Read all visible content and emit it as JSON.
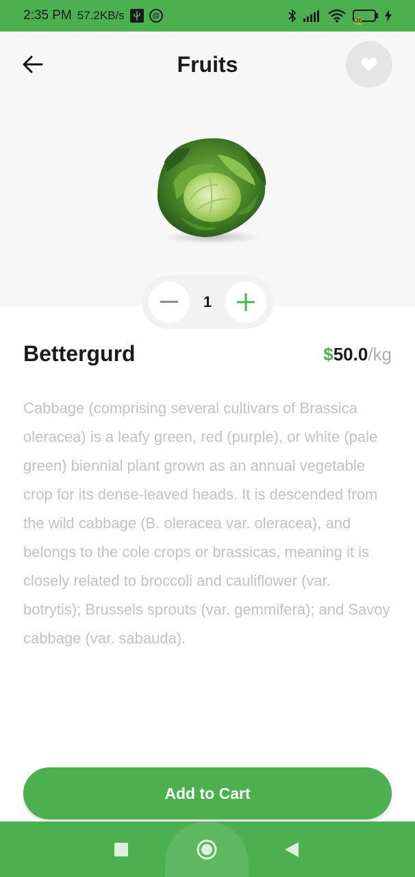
{
  "status_bar": {
    "time": "2:35 PM",
    "speed": "57.2KB/s",
    "battery": "36",
    "icons": [
      "usb-icon",
      "at-icon",
      "bluetooth-icon",
      "signal-icon",
      "wifi-icon",
      "battery-icon",
      "charging-icon"
    ]
  },
  "header": {
    "title": "Fruits",
    "back_icon": "arrow-left-icon",
    "favorite_icon": "heart-icon"
  },
  "product": {
    "image": "cabbage-image",
    "quantity": "1",
    "name": "Bettergurd",
    "price_currency": "$",
    "price_amount": "50.0",
    "price_unit": "/kg",
    "description": "Cabbage (comprising several cultivars of Brassica oleracea) is a leafy green, red (purple), or white (pale green) biennial plant grown as an annual vegetable crop for its dense-leaved heads. It is descended from the wild cabbage (B. oleracea var. oleracea), and belongs to the cole crops or brassicas, meaning it is closely related to broccoli and cauliflower (var. botrytis); Brussels sprouts (var. gemmifera); and Savoy cabbage (var. sabauda)."
  },
  "actions": {
    "add_to_cart_label": "Add to Cart"
  },
  "nav": {
    "icons": [
      "square-recents-icon",
      "circle-home-icon",
      "triangle-back-icon"
    ]
  },
  "colors": {
    "accent": "#4caf50",
    "hero_bg": "#f7f7f7",
    "description_text": "#c2c2c2"
  }
}
